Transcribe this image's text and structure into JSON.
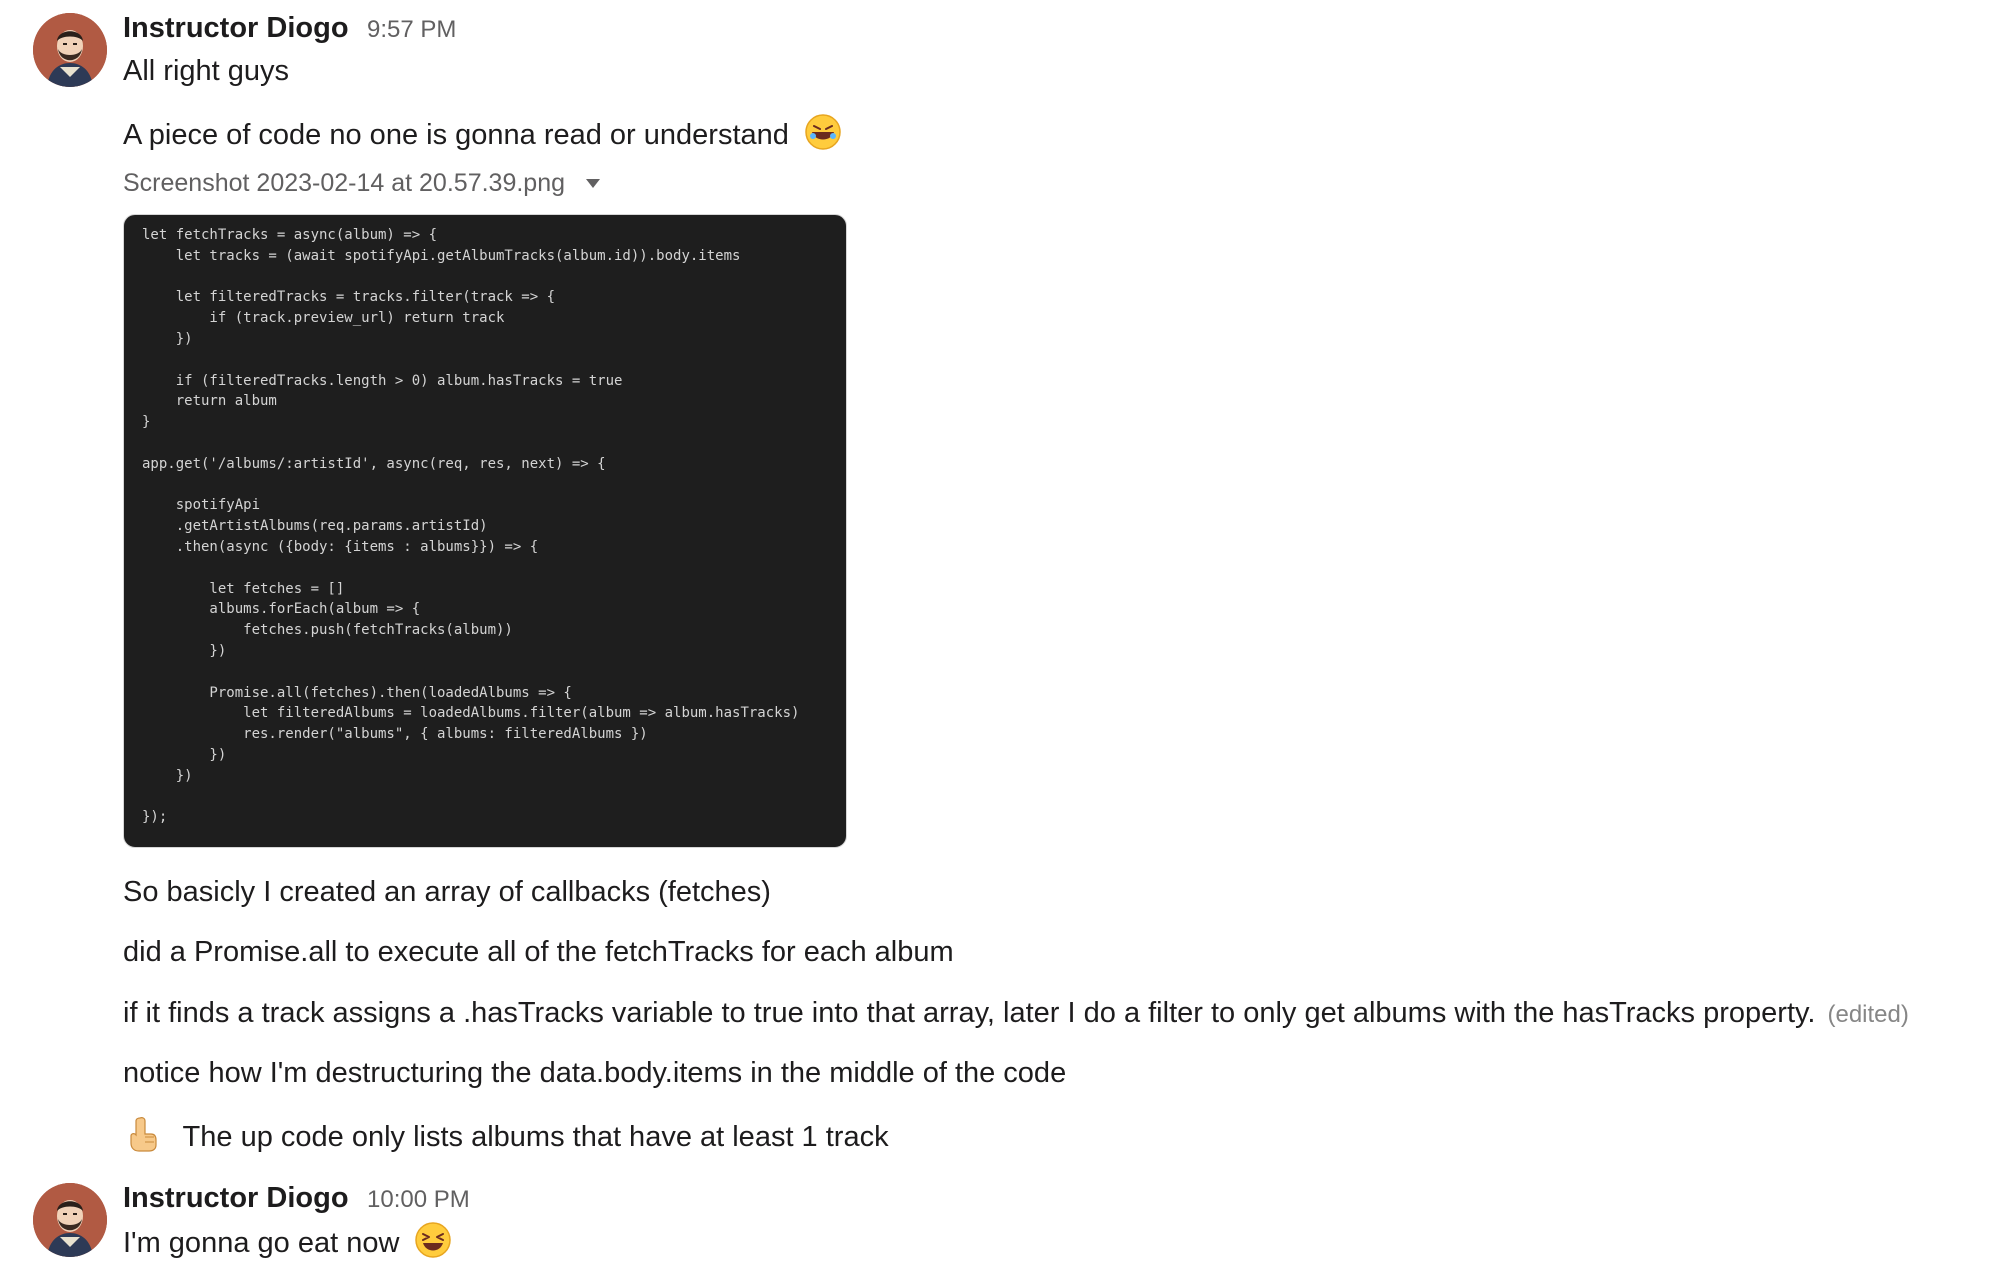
{
  "messages": [
    {
      "author": "Instructor Diogo",
      "time": "9:57 PM",
      "lines": [
        "All right guys",
        "A piece of code no one is gonna read or understand"
      ],
      "attachment": {
        "filename": "Screenshot 2023-02-14 at 20.57.39.png",
        "code_lines": [
          "let fetchTracks = async(album) => {",
          "    let tracks = (await spotifyApi.getAlbumTracks(album.id)).body.items",
          "",
          "    let filteredTracks = tracks.filter(track => {",
          "        if (track.preview_url) return track",
          "    })",
          "",
          "    if (filteredTracks.length > 0) album.hasTracks = true",
          "    return album",
          "}",
          "",
          "app.get('/albums/:artistId', async(req, res, next) => {",
          "",
          "    spotifyApi",
          "    .getArtistAlbums(req.params.artistId)",
          "    .then(async ({body: {items : albums}}) => {",
          "",
          "        let fetches = []",
          "        albums.forEach(album => {",
          "            fetches.push(fetchTracks(album))",
          "        })",
          "",
          "        Promise.all(fetches).then(loadedAlbums => {",
          "            let filteredAlbums = loadedAlbums.filter(album => album.hasTracks)",
          "            res.render(\"albums\", { albums: filteredAlbums })",
          "        })",
          "    })",
          "",
          "});"
        ]
      },
      "followups": [
        "So basicly I created an array of callbacks (fetches)",
        "did a Promise.all to execute all of the fetchTracks for each album",
        "if it finds a track assigns a .hasTracks variable to true into that array, later I do a filter to only get albums with the hasTracks property.",
        "notice how I'm destructuring the data.body.items in the middle of the code",
        "The up code only lists albums that have at least 1 track"
      ],
      "edited_label": "(edited)",
      "emojis": [
        "rolling-on-the-floor-laughing",
        "point-up"
      ]
    },
    {
      "author": "Instructor Diogo",
      "time": "10:00 PM",
      "lines": [
        "I'm gonna go eat now"
      ],
      "emojis": [
        "laughing"
      ]
    }
  ],
  "colors": {
    "author": "#1d1c1d",
    "timestamp": "#616061",
    "edited": "#868686",
    "code_background": "#1e1e1e"
  }
}
